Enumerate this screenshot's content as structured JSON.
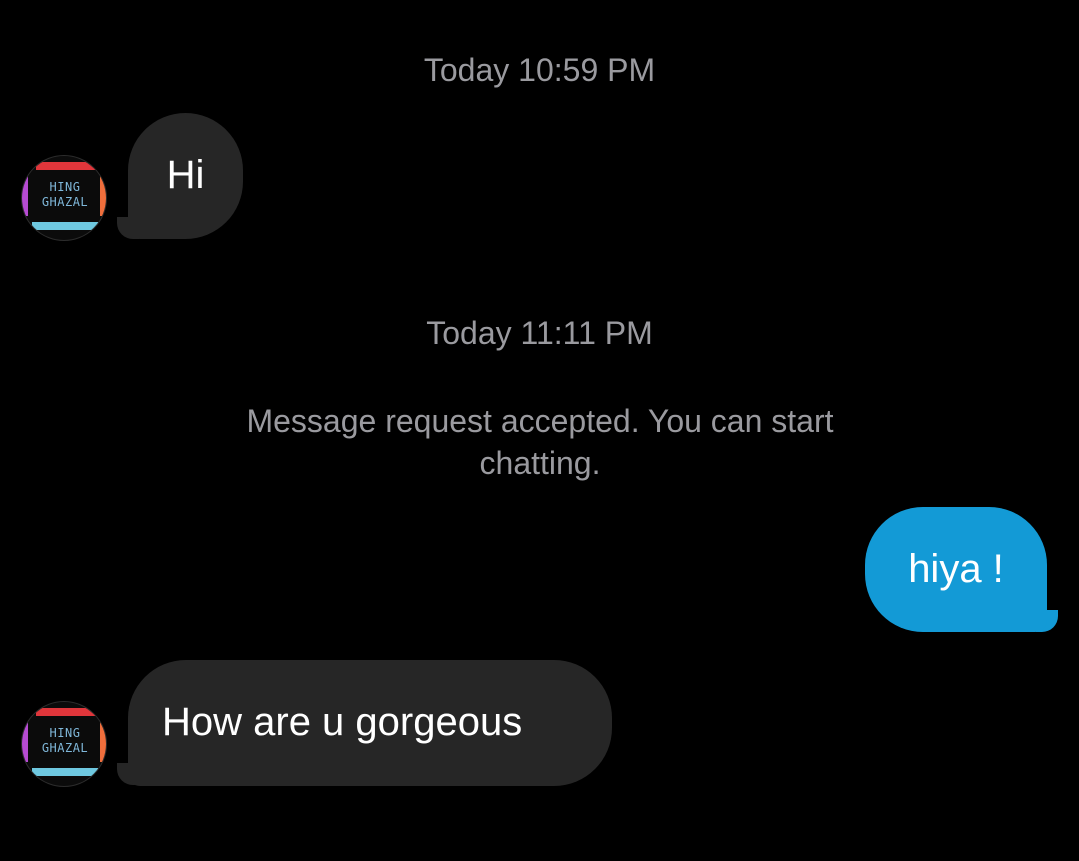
{
  "timestamps": {
    "first": "Today 10:59 PM",
    "second": "Today 11:11 PM"
  },
  "system_notice": "Message request accepted. You can start chatting.",
  "contact": {
    "avatar_text_line1": "HING",
    "avatar_text_line2": "GHAZAL"
  },
  "messages": [
    {
      "sender": "contact",
      "text": "Hi"
    },
    {
      "sender": "me",
      "text": "hiya !"
    },
    {
      "sender": "contact",
      "text": "How are u gorgeous"
    }
  ],
  "colors": {
    "background": "#000000",
    "incoming_bubble": "#262626",
    "outgoing_bubble": "#139ad6",
    "meta_text": "#9a9a9f"
  }
}
